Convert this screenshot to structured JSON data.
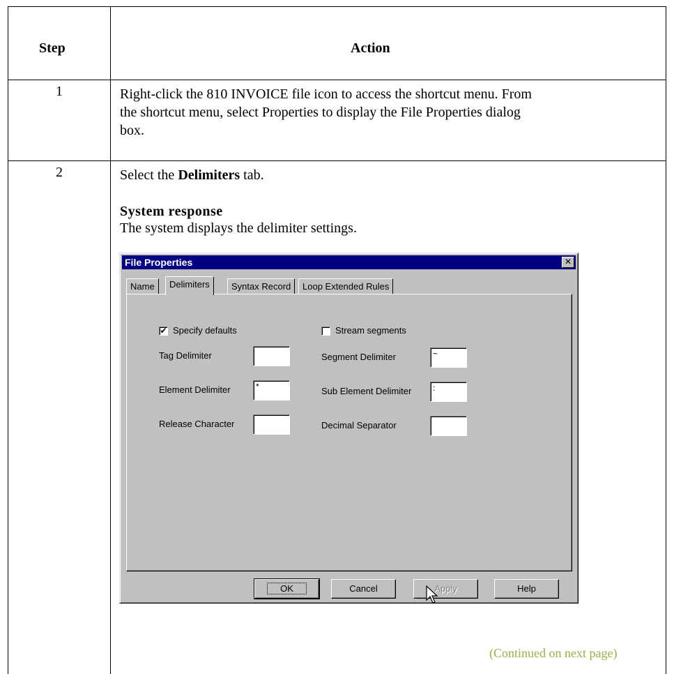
{
  "table": {
    "header_step": "Step",
    "header_action": "Action",
    "rows": [
      {
        "step": "1",
        "text_line1": "Right-click the 810 INVOICE file icon to access the shortcut menu. From",
        "text_line2": "the shortcut menu, select Properties to display the File Properties dialog",
        "text_line3": "box."
      },
      {
        "step": "2",
        "text_pre": "Select the ",
        "text_bold": "Delimiters",
        "text_post": " tab.",
        "response_heading": "System response",
        "response_text": "The system displays the delimiter settings."
      }
    ],
    "continued": "(Continued on next page)"
  },
  "dialog": {
    "title": "File Properties",
    "close_glyph": "✕",
    "tabs": [
      "Name",
      "Delimiters",
      "Syntax Record",
      "Loop Extended Rules"
    ],
    "active_tab": "Delimiters",
    "specify_defaults": {
      "label": "Specify defaults",
      "checked": true,
      "mark": "✔"
    },
    "stream_segments": {
      "label": "Stream segments",
      "checked": false
    },
    "fields": {
      "tag_delimiter": {
        "label": "Tag Delimiter",
        "value": ""
      },
      "element_delimiter": {
        "label": "Element Delimiter",
        "value": "*"
      },
      "release_character": {
        "label": "Release Character",
        "value": ""
      },
      "segment_delimiter": {
        "label": "Segment Delimiter",
        "value": "~"
      },
      "sub_element_delimiter": {
        "label": "Sub Element Delimiter",
        "value": ":"
      },
      "decimal_separator": {
        "label": "Decimal Separator",
        "value": ""
      }
    },
    "buttons": {
      "ok": "OK",
      "cancel": "Cancel",
      "apply": "Apply",
      "help": "Help"
    }
  }
}
